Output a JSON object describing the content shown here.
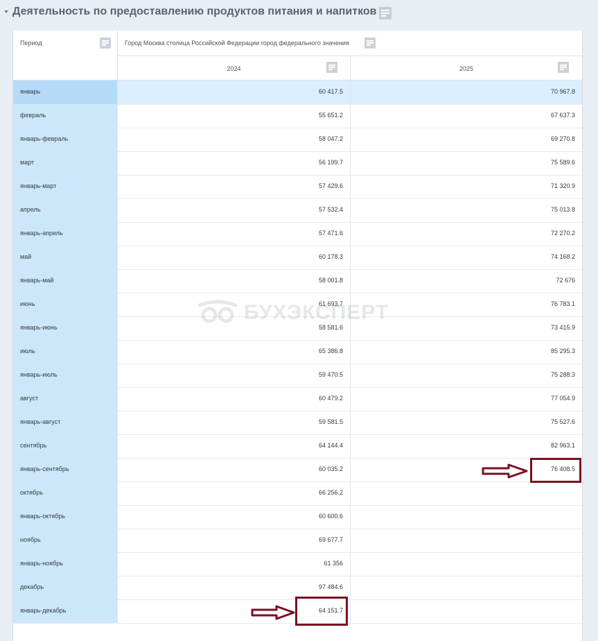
{
  "section": {
    "title": "Деятельность по предоставлению продуктов питания и напитков",
    "icons": [
      "chevron-down-icon",
      "filter-icon"
    ]
  },
  "table": {
    "header": {
      "period_label": "Период",
      "region_label": "Город Москва столица Российской Федерации город федерального значения",
      "years": [
        "2024",
        "2025"
      ]
    },
    "rows": [
      {
        "period": "январь",
        "v2024": "60 417.5",
        "v2025": "70 967.8"
      },
      {
        "period": "февраль",
        "v2024": "55 651.2",
        "v2025": "67 637.3"
      },
      {
        "period": "январь-февраль",
        "v2024": "58 047.2",
        "v2025": "69 270.8"
      },
      {
        "period": "март",
        "v2024": "56 199.7",
        "v2025": "75 589.6"
      },
      {
        "period": "январь-март",
        "v2024": "57 429.6",
        "v2025": "71 320.9"
      },
      {
        "period": "апрель",
        "v2024": "57 532.4",
        "v2025": "75 013.8"
      },
      {
        "period": "январь-апрель",
        "v2024": "57 471.6",
        "v2025": "72 270.2"
      },
      {
        "period": "май",
        "v2024": "60 178.3",
        "v2025": "74 168.2"
      },
      {
        "period": "январь-май",
        "v2024": "58 001.8",
        "v2025": "72 676"
      },
      {
        "period": "июнь",
        "v2024": "61 693.7",
        "v2025": "76 783.1"
      },
      {
        "period": "январь-июнь",
        "v2024": "58 581.6",
        "v2025": "73 415.9"
      },
      {
        "period": "июль",
        "v2024": "65 386.8",
        "v2025": "85 295.3"
      },
      {
        "period": "январь-июль",
        "v2024": "59 470.5",
        "v2025": "75 288.3"
      },
      {
        "period": "август",
        "v2024": "60 479.2",
        "v2025": "77 054.9"
      },
      {
        "period": "январь-август",
        "v2024": "59 581.5",
        "v2025": "75 527.6"
      },
      {
        "period": "сентябрь",
        "v2024": "64 144.4",
        "v2025": "82 963.1"
      },
      {
        "period": "январь-сентябрь",
        "v2024": "60 035.2",
        "v2025": "76 408.5"
      },
      {
        "period": "октябрь",
        "v2024": "66 256.2",
        "v2025": ""
      },
      {
        "period": "январь-октябрь",
        "v2024": "60 600.6",
        "v2025": ""
      },
      {
        "period": "ноябрь",
        "v2024": "69 677.7",
        "v2025": ""
      },
      {
        "period": "январь-ноябрь",
        "v2024": "61 356",
        "v2025": ""
      },
      {
        "period": "декабрь",
        "v2024": "97 484.6",
        "v2025": ""
      },
      {
        "period": "январь-декабрь",
        "v2024": "64 151.7",
        "v2025": ""
      }
    ]
  },
  "watermark": {
    "text": "БУХЭКСПЕРТ",
    "icon": "owl-logo-icon"
  },
  "annotations": {
    "color": "#7a1020",
    "icons": [
      "arrow-right-icon"
    ]
  }
}
